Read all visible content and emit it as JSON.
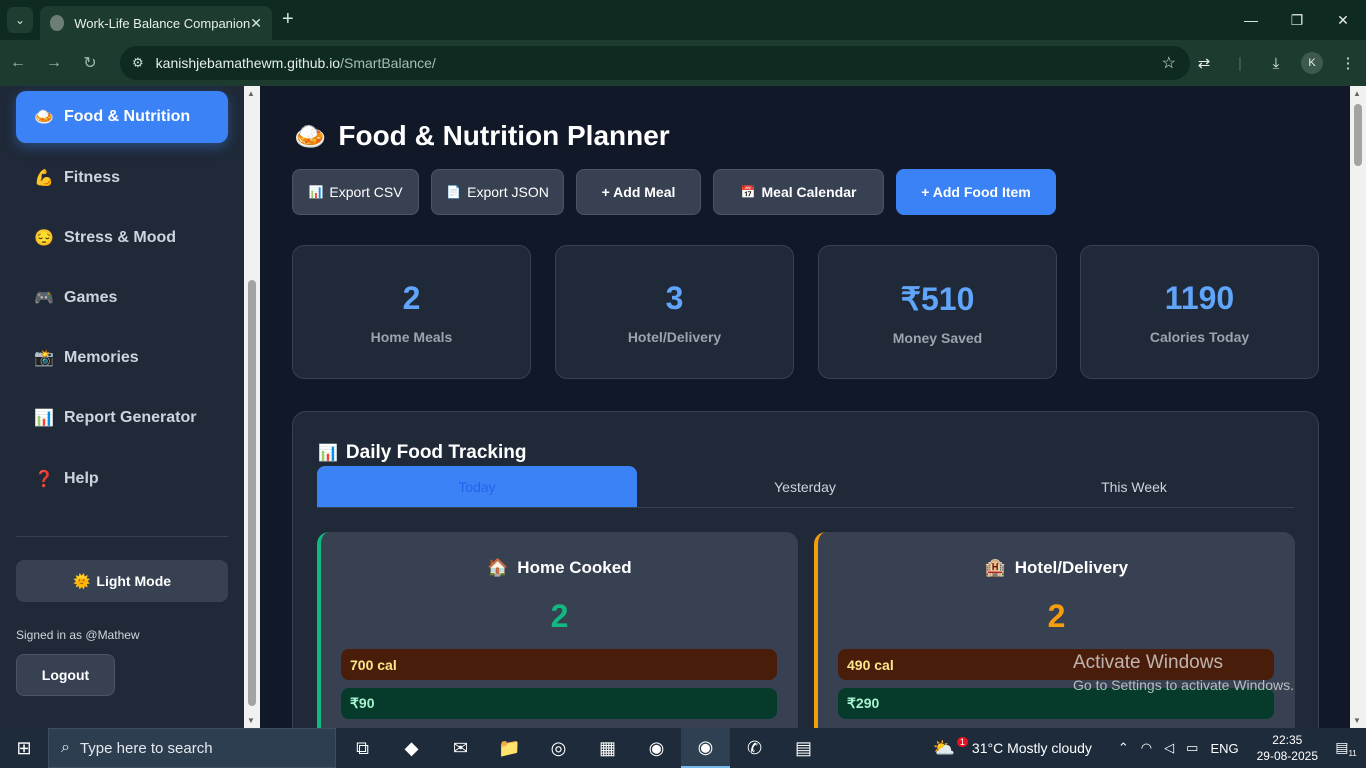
{
  "browser": {
    "tab_title": "Work-Life Balance Companion",
    "url_host": "kanishjebamathewm.github.io",
    "url_path": "/SmartBalance/",
    "profile_initial": "K"
  },
  "sidebar": {
    "items": [
      {
        "icon": "🍛",
        "label": "Food & Nutrition"
      },
      {
        "icon": "💪",
        "label": "Fitness"
      },
      {
        "icon": "😔",
        "label": "Stress & Mood"
      },
      {
        "icon": "🎮",
        "label": "Games"
      },
      {
        "icon": "📸",
        "label": "Memories"
      },
      {
        "icon": "📊",
        "label": "Report Generator"
      },
      {
        "icon": "❓",
        "label": "Help"
      }
    ],
    "light_mode_icon": "🌞",
    "light_mode_label": "Light Mode",
    "signed_in": "Signed in as @Mathew",
    "logout_label": "Logout"
  },
  "main": {
    "title_icon": "🍛",
    "title": "Food & Nutrition Planner",
    "buttons": {
      "export_csv_icon": "📊",
      "export_csv": "Export CSV",
      "export_json_icon": "📄",
      "export_json": "Export JSON",
      "add_meal": "+ Add Meal",
      "meal_calendar_icon": "📅",
      "meal_calendar": "Meal Calendar",
      "add_food": "+ Add Food Item"
    },
    "stats": [
      {
        "value": "2",
        "label": "Home Meals"
      },
      {
        "value": "3",
        "label": "Hotel/Delivery"
      },
      {
        "value": "₹510",
        "label": "Money Saved"
      },
      {
        "value": "1190",
        "label": "Calories Today"
      }
    ],
    "tracking": {
      "icon": "📊",
      "title": "Daily Food Tracking",
      "tabs": [
        "Today",
        "Yesterday",
        "This Week"
      ],
      "home": {
        "icon": "🏠",
        "title": "Home Cooked",
        "count": "2",
        "calories": "700 cal",
        "money": "₹90"
      },
      "hotel": {
        "icon": "🏨",
        "title": "Hotel/Delivery",
        "count": "2",
        "calories": "490 cal",
        "money": "₹290"
      }
    }
  },
  "watermark": {
    "line1": "Activate Windows",
    "line2": "Go to Settings to activate Windows."
  },
  "taskbar": {
    "search_placeholder": "Type here to search",
    "weather_badge": "1",
    "weather": "31°C  Mostly cloudy",
    "language": "ENG",
    "time": "22:35",
    "date": "29-08-2025",
    "notification_count": "11"
  }
}
